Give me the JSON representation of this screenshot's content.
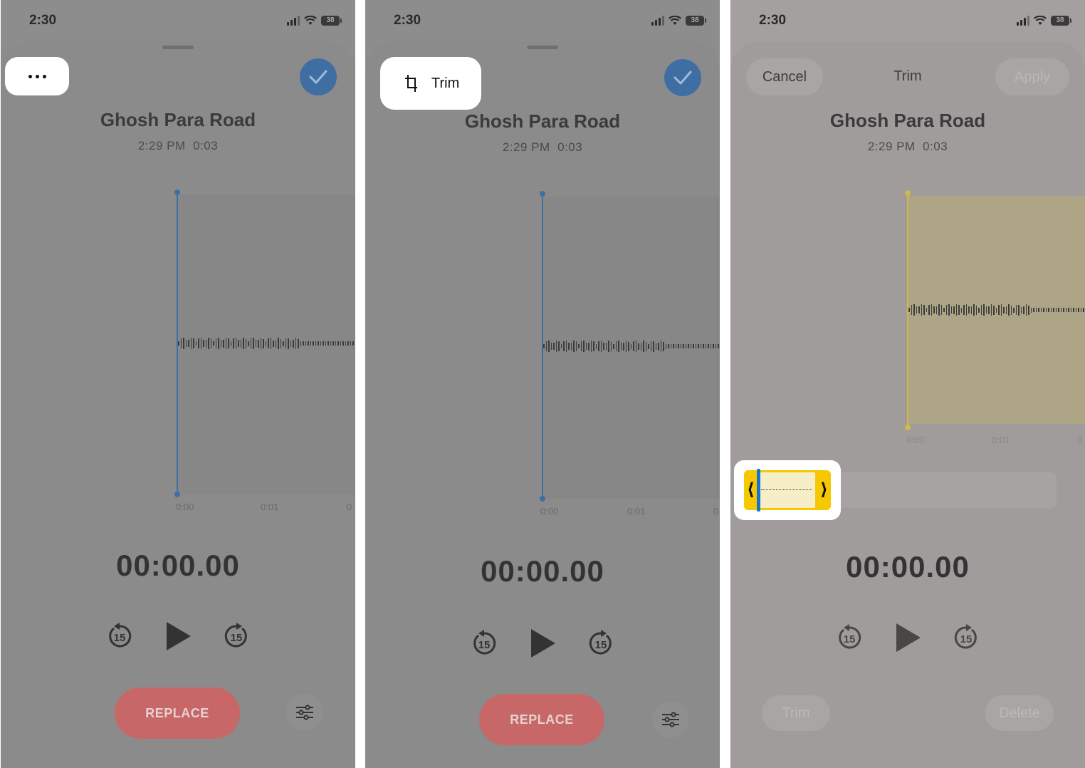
{
  "status": {
    "time": "2:30",
    "battery": "38"
  },
  "recording": {
    "title": "Ghosh Para Road",
    "time_of_day": "2:29 PM",
    "duration": "0:03"
  },
  "player": {
    "timer": "00:00.00",
    "skip_back": "15",
    "skip_forward": "15"
  },
  "ticks": [
    "0:00",
    "0:01",
    "0"
  ],
  "actions": {
    "replace_label": "REPLACE"
  },
  "menu": {
    "trim_label": "Trim"
  },
  "trim_mode": {
    "cancel_label": "Cancel",
    "title": "Trim",
    "apply_label": "Apply",
    "trim_button": "Trim",
    "delete_button": "Delete"
  },
  "colors": {
    "accent_blue": "#3f6fa2",
    "replace_red": "#c86767",
    "trim_yellow": "#f5c800"
  }
}
